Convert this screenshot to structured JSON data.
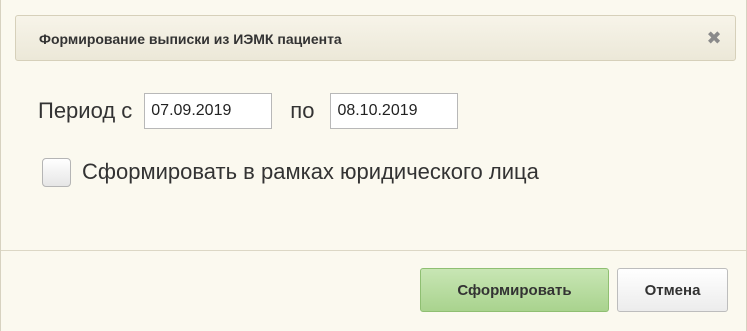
{
  "dialog": {
    "title": "Формирование выписки из ИЭМК пациента",
    "close_icon": "close-icon",
    "close_glyph": "✖"
  },
  "period": {
    "label": "Период с",
    "from_value": "07.09.2019",
    "to_label": "по",
    "to_value": "08.10.2019"
  },
  "legal_entity": {
    "label": "Сформировать в рамках юридического лица",
    "checked": false
  },
  "buttons": {
    "submit_label": "Сформировать",
    "cancel_label": "Отмена"
  },
  "colors": {
    "background": "#fbf9ef",
    "title_bar": "#ece8d8",
    "primary_button": "#b8dca0"
  }
}
